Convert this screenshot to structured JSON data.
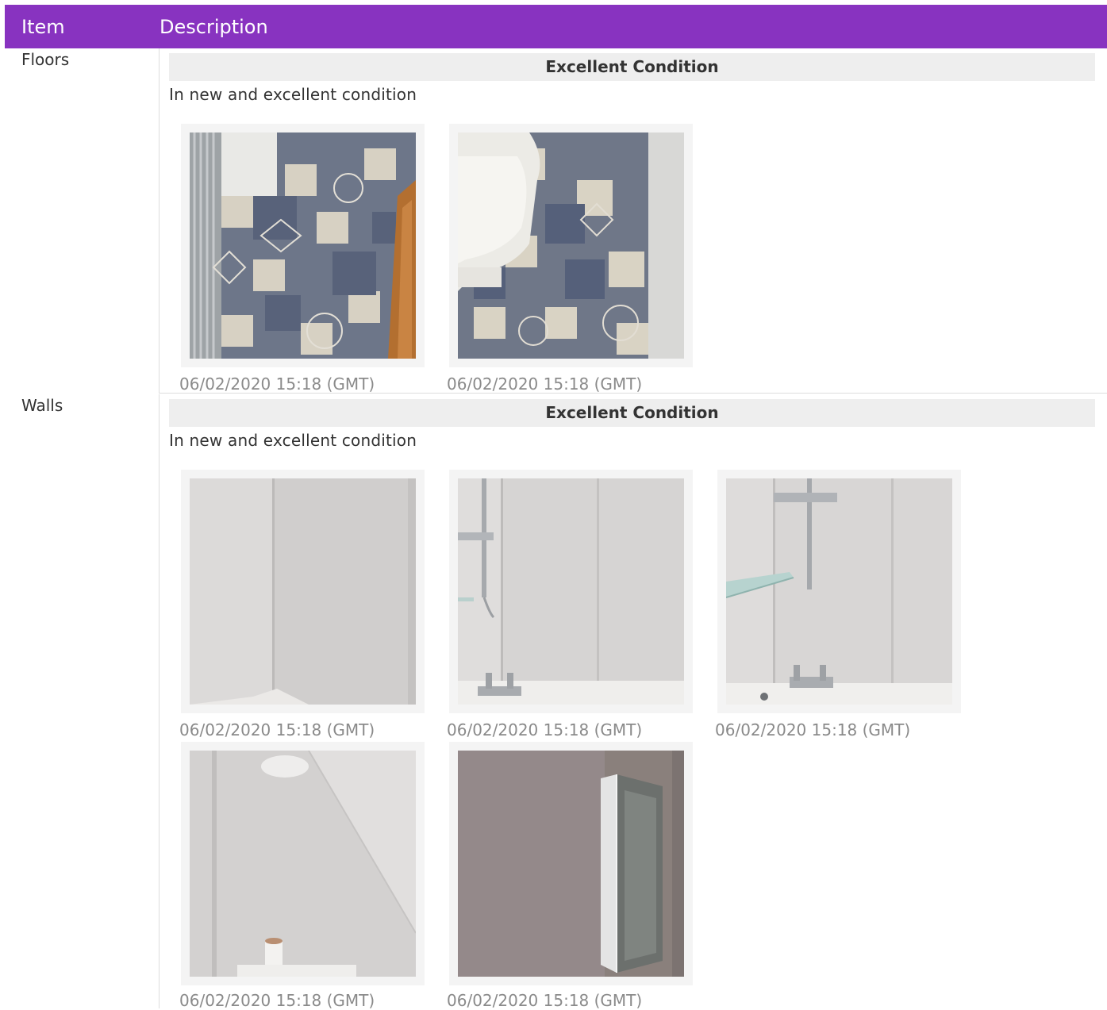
{
  "table": {
    "headers": {
      "item": "Item",
      "description": "Description"
    },
    "accent_color": "#8833c0"
  },
  "rows": [
    {
      "item": "Floors",
      "condition": "Excellent Condition",
      "description": "In new and excellent condition",
      "photos": [
        {
          "timestamp": "06/02/2020 15:18 (GMT)",
          "subject": "patterned floor tiles by radiator and door"
        },
        {
          "timestamp": "06/02/2020 15:18 (GMT)",
          "subject": "patterned floor tiles beside toilet"
        }
      ]
    },
    {
      "item": "Walls",
      "condition": "Excellent Condition",
      "description": "In new and excellent condition",
      "photos": [
        {
          "timestamp": "06/02/2020 15:18 (GMT)",
          "subject": "white wall panels corner"
        },
        {
          "timestamp": "06/02/2020 15:18 (GMT)",
          "subject": "wall panels with shower riser"
        },
        {
          "timestamp": "06/02/2020 15:18 (GMT)",
          "subject": "wall panels with shower and glass shelf"
        },
        {
          "timestamp": "06/02/2020 15:18 (GMT)",
          "subject": "sloped ceiling wall panels"
        },
        {
          "timestamp": "06/02/2020 15:18 (GMT)",
          "subject": "wall panel with mirror cabinet"
        }
      ]
    }
  ]
}
